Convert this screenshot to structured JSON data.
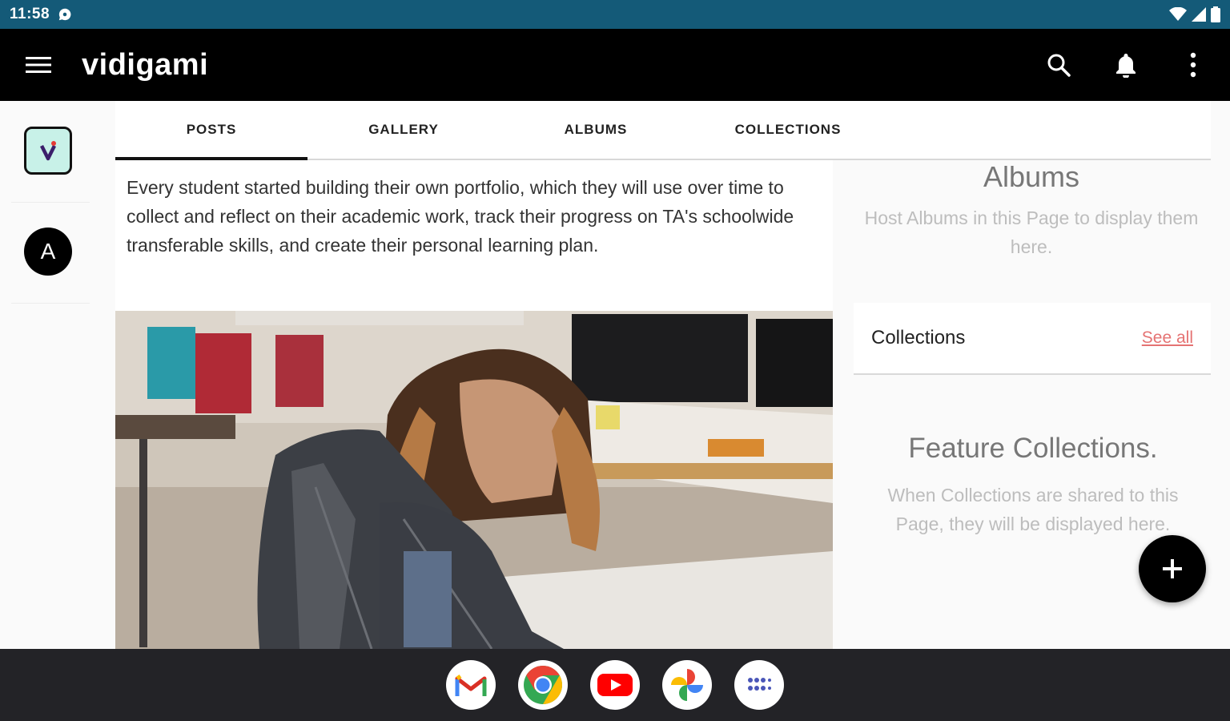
{
  "status_bar": {
    "time": "11:58"
  },
  "app_bar": {
    "title": "vidigami"
  },
  "rail": {
    "avatar_letter": "A"
  },
  "tabs": [
    {
      "label": "POSTS",
      "active": true
    },
    {
      "label": "GALLERY",
      "active": false
    },
    {
      "label": "ALBUMS",
      "active": false
    },
    {
      "label": "COLLECTIONS",
      "active": false
    }
  ],
  "post": {
    "text": "Every student started building their own portfolio, which they will use over time to collect and reflect on their academic work, track their progress on TA's schoolwide transferable skills, and create their personal learning plan."
  },
  "sidebar": {
    "albums_title": "Albums",
    "albums_message": "Host Albums in this Page to display them here.",
    "collections_title": "Collections",
    "see_all_label": "See all",
    "feature_title": "Feature Collections.",
    "feature_message": "When Collections are shared to this Page, they will be displayed here."
  },
  "colors": {
    "status_bar": "#145a78",
    "app_bar": "#000000",
    "link": "#e57373",
    "page_icon_bg": "#c8f1e8"
  },
  "icons": {
    "menu": "menu-icon",
    "search": "search-icon",
    "notifications": "bell-icon",
    "more": "more-vert-icon",
    "fab": "plus-icon"
  },
  "dock": [
    "Gmail",
    "Chrome",
    "YouTube",
    "Photos",
    "App launcher"
  ]
}
